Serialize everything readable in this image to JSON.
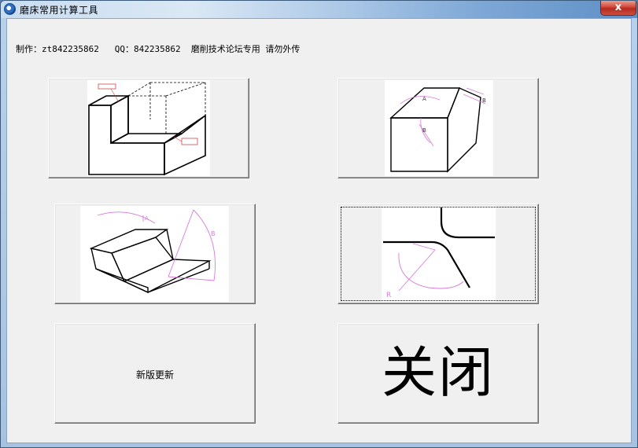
{
  "window": {
    "title": "磨床常用计算工具",
    "close_glyph": "x"
  },
  "header": {
    "info_text": "制作：zt842235862   QQ：842235862  磨削技术论坛专用 请勿外传"
  },
  "buttons": {
    "update_label": "新版更新",
    "close_label": "关闭"
  },
  "icons": {
    "step_block": "step-block-diagram-icon",
    "chamfer_block": "chamfer-angle-diagram-icon",
    "incline_block": "inclined-step-diagram-icon",
    "radius_profile": "radius-profile-diagram-icon"
  },
  "colors": {
    "diagram_annotation": "#d87ad8",
    "window_close": "#c9503f"
  }
}
